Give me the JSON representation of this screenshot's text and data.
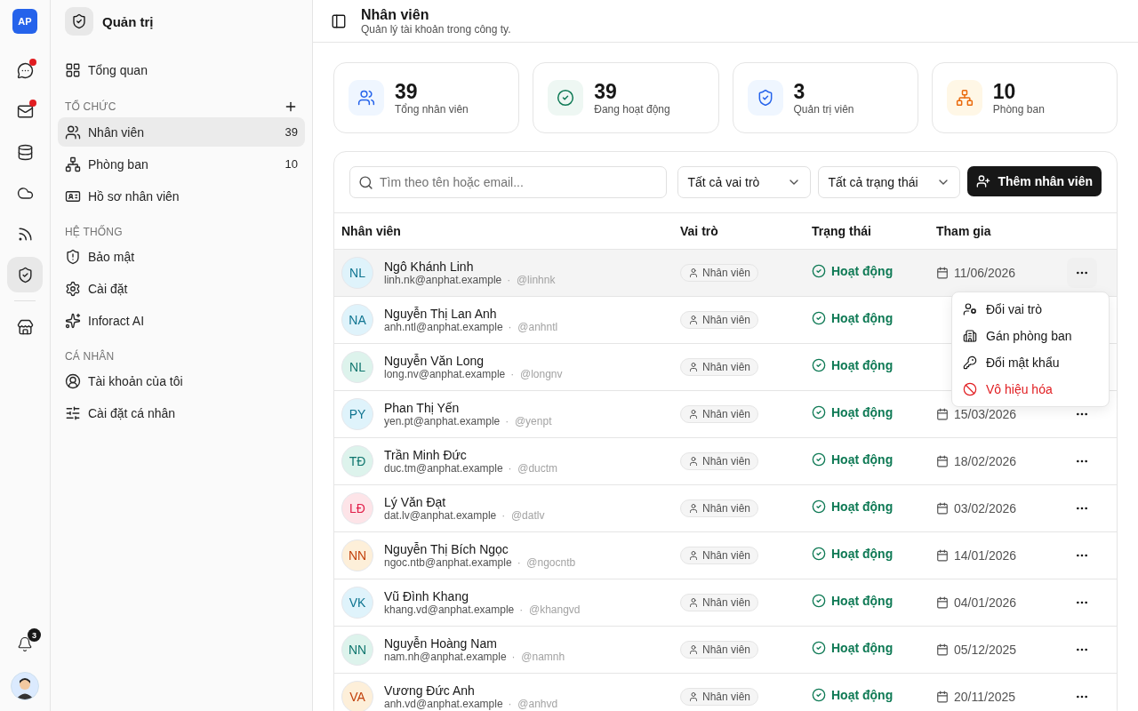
{
  "rail": {
    "logo": "AP",
    "items": [
      {
        "dot": true,
        "selected": false
      },
      {
        "dot": true,
        "selected": false
      },
      {
        "dot": false,
        "selected": false
      },
      {
        "dot": false,
        "selected": false
      },
      {
        "dot": false,
        "selected": false
      },
      {
        "dot": false,
        "selected": true
      },
      {
        "dot": false,
        "selected": false
      }
    ],
    "notifications": "3"
  },
  "sidebar": {
    "title": "Quản trị",
    "top": {
      "label": "Tổng quan",
      "selected": false
    },
    "sections": [
      {
        "title": "TỔ CHỨC",
        "addable": true,
        "items": [
          {
            "label": "Nhân viên",
            "count": "39",
            "selected": true
          },
          {
            "label": "Phòng ban",
            "count": "10",
            "selected": false
          },
          {
            "label": "Hồ sơ nhân viên",
            "selected": false
          }
        ]
      },
      {
        "title": "HỆ THỐNG",
        "addable": false,
        "items": [
          {
            "label": "Bảo mật",
            "selected": false
          },
          {
            "label": "Cài đặt",
            "selected": false
          },
          {
            "label": "Inforact AI",
            "selected": false
          }
        ]
      },
      {
        "title": "CÁ NHÂN",
        "addable": false,
        "items": [
          {
            "label": "Tài khoản của tôi",
            "selected": false
          },
          {
            "label": "Cài đặt cá nhân",
            "selected": false
          }
        ]
      }
    ]
  },
  "header": {
    "title": "Nhân viên",
    "subtitle": "Quản lý tài khoản trong công ty."
  },
  "stats": [
    {
      "value": "39",
      "label": "Tổng nhân viên"
    },
    {
      "value": "39",
      "label": "Đang hoạt động"
    },
    {
      "value": "3",
      "label": "Quản trị viên"
    },
    {
      "value": "10",
      "label": "Phòng ban"
    }
  ],
  "toolbar": {
    "search_placeholder": "Tìm theo tên hoặc email...",
    "filters": [
      "Tất cả vai trò",
      "Tất cả trạng thái"
    ],
    "add_button": "Thêm nhân viên"
  },
  "table": {
    "columns": [
      "Nhân viên",
      "Vai trò",
      "Trạng thái",
      "Tham gia"
    ],
    "rows": [
      {
        "initials": "NL",
        "color": "#0e7490",
        "name": "Ngô Khánh Linh",
        "email": "linh.nk@anphat.example",
        "handle": "·  @linhnk",
        "role": "Nhân viên",
        "status": "Hoạt động",
        "joined": "11/06/2026",
        "selected": true
      },
      {
        "initials": "NA",
        "color": "#0e7490",
        "name": "Nguyễn Thị Lan Anh",
        "email": "anh.ntl@anphat.example",
        "handle": "·  @anhntl",
        "role": "Nhân viên",
        "status": "Hoạt động",
        "selected": false
      },
      {
        "initials": "NL",
        "color": "#0f766e",
        "name": "Nguyễn Văn Long",
        "email": "long.nv@anphat.example",
        "handle": "·  @longnv",
        "role": "Nhân viên",
        "status": "Hoạt động",
        "selected": false
      },
      {
        "initials": "PY",
        "color": "#0e7490",
        "name": "Phan Thị Yến",
        "email": "yen.pt@anphat.example",
        "handle": "·  @yenpt",
        "role": "Nhân viên",
        "status": "Hoạt động",
        "joined": "15/03/2026",
        "selected": false
      },
      {
        "initials": "TĐ",
        "color": "#0f766e",
        "name": "Trần Minh Đức",
        "email": "duc.tm@anphat.example",
        "handle": "·  @ductm",
        "role": "Nhân viên",
        "status": "Hoạt động",
        "joined": "18/02/2026",
        "selected": false
      },
      {
        "initials": "LĐ",
        "color": "#e11d48",
        "name": "Lý Văn Đạt",
        "email": "dat.lv@anphat.example",
        "handle": "·  @datlv",
        "role": "Nhân viên",
        "status": "Hoạt động",
        "joined": "03/02/2026",
        "selected": false
      },
      {
        "initials": "NN",
        "color": "#c2410c",
        "name": "Nguyễn Thị Bích Ngọc",
        "email": "ngoc.ntb@anphat.example",
        "handle": "·  @ngocntb",
        "role": "Nhân viên",
        "status": "Hoạt động",
        "joined": "14/01/2026",
        "selected": false
      },
      {
        "initials": "VK",
        "color": "#0e7490",
        "name": "Vũ Đình Khang",
        "email": "khang.vd@anphat.example",
        "handle": "·  @khangvd",
        "role": "Nhân viên",
        "status": "Hoạt động",
        "joined": "04/01/2026",
        "selected": false
      },
      {
        "initials": "NN",
        "color": "#0f766e",
        "name": "Nguyễn Hoàng Nam",
        "email": "nam.nh@anphat.example",
        "handle": "·  @namnh",
        "role": "Nhân viên",
        "status": "Hoạt động",
        "joined": "05/12/2025",
        "selected": false
      },
      {
        "initials": "VA",
        "color": "#c2410c",
        "name": "Vương Đức Anh",
        "email": "anh.vd@anphat.example",
        "handle": "·  @anhvd",
        "role": "Nhân viên",
        "status": "Hoạt động",
        "joined": "20/11/2025",
        "selected": false
      }
    ]
  },
  "row_menu": {
    "items": [
      {
        "label": "Đổi vai trò",
        "kind": "normal"
      },
      {
        "label": "Gán phòng ban",
        "kind": "normal"
      },
      {
        "label": "Đổi mật khẩu",
        "kind": "normal"
      },
      {
        "label": "Vô hiệu hóa",
        "kind": "danger"
      }
    ]
  }
}
